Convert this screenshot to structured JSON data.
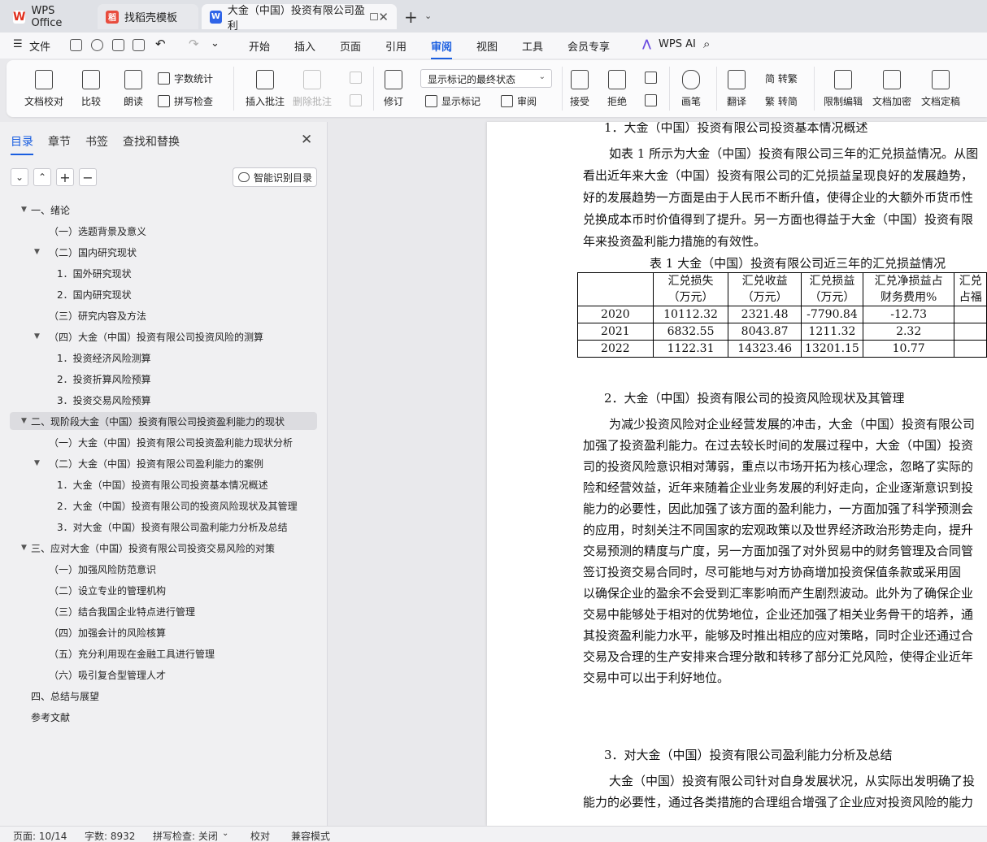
{
  "tabs": {
    "wps": "WPS Office",
    "daoke": "找稻壳模板",
    "doc": "大金（中国）投资有限公司盈利"
  },
  "menu": {
    "file": "文件",
    "items": [
      "开始",
      "插入",
      "页面",
      "引用",
      "审阅",
      "视图",
      "工具",
      "会员专享"
    ],
    "active": "审阅",
    "wps_ai": "WPS AI"
  },
  "ribbon": {
    "doc_check": "文档校对",
    "compare": "比较",
    "read_aloud": "朗读",
    "word_count": "字数统计",
    "spell_check": "拼写检查",
    "insert_comment": "插入批注",
    "delete_comment": "删除批注",
    "revise": "修订",
    "markup_state": "显示标记的最终状态",
    "show_markup": "显示标记",
    "review": "审阅",
    "accept": "接受",
    "reject": "拒绝",
    "pen": "画笔",
    "translate": "翻译",
    "to_traditional": "简 转繁",
    "to_simplified": "繁 转简",
    "restrict_edit": "限制编辑",
    "encrypt": "文档加密",
    "finalize": "文档定稿"
  },
  "nav": {
    "tabs": [
      "目录",
      "章节",
      "书签",
      "查找和替换"
    ],
    "smart_toc": "智能识别目录",
    "toc": [
      {
        "label": "一、绪论",
        "level": 0,
        "toggle": "open"
      },
      {
        "label": "（一）选题背景及意义",
        "level": 1,
        "toggle": ""
      },
      {
        "label": "（二）国内研究现状",
        "level": 1,
        "toggle": "open"
      },
      {
        "label": "1．国外研究现状",
        "level": 2,
        "toggle": ""
      },
      {
        "label": "2．国内研究现状",
        "level": 2,
        "toggle": ""
      },
      {
        "label": "（三）研究内容及方法",
        "level": 1,
        "toggle": ""
      },
      {
        "label": "（四）大金（中国）投资有限公司投资风险的测算",
        "level": 1,
        "toggle": "open"
      },
      {
        "label": "1．投资经济风险测算",
        "level": 2,
        "toggle": ""
      },
      {
        "label": "2．投资折算风险预算",
        "level": 2,
        "toggle": ""
      },
      {
        "label": "3．投资交易风险预算",
        "level": 2,
        "toggle": ""
      },
      {
        "label": "二、现阶段大金（中国）投资有限公司投资盈利能力的现状",
        "level": 0,
        "toggle": "open"
      },
      {
        "label": "（一）大金（中国）投资有限公司投资盈利能力现状分析",
        "level": 1,
        "toggle": ""
      },
      {
        "label": "（二）大金（中国）投资有限公司盈利能力的案例",
        "level": 1,
        "toggle": "open"
      },
      {
        "label": "1．大金（中国）投资有限公司投资基本情况概述",
        "level": 2,
        "toggle": ""
      },
      {
        "label": "2．大金（中国）投资有限公司的投资风险现状及其管理",
        "level": 2,
        "toggle": ""
      },
      {
        "label": "3．对大金（中国）投资有限公司盈利能力分析及总结",
        "level": 2,
        "toggle": ""
      },
      {
        "label": "三、应对大金（中国）投资有限公司投资交易风险的对策",
        "level": 0,
        "toggle": "open"
      },
      {
        "label": "（一）加强风险防范意识",
        "level": 1,
        "toggle": ""
      },
      {
        "label": "（二）设立专业的管理机构",
        "level": 1,
        "toggle": ""
      },
      {
        "label": "（三）结合我国企业特点进行管理",
        "level": 1,
        "toggle": ""
      },
      {
        "label": "（四）加强会计的风险核算",
        "level": 1,
        "toggle": ""
      },
      {
        "label": "（五）充分利用现在金融工具进行管理",
        "level": 1,
        "toggle": ""
      },
      {
        "label": "（六）吸引复合型管理人才",
        "level": 1,
        "toggle": ""
      },
      {
        "label": "四、总结与展望",
        "level": 0,
        "toggle": "none"
      },
      {
        "label": "参考文献",
        "level": 0,
        "toggle": "none"
      }
    ],
    "selected_index": 10
  },
  "doc": {
    "h1": "1．大金（中国）投资有限公司投资基本情况概述",
    "p1": [
      "如表 1 所示为大金（中国）投资有限公司三年的汇兑损益情况。从图",
      "看出近年来大金（中国）投资有限公司的汇兑损益呈现良好的发展趋势，",
      "好的发展趋势一方面是由于人民币不断升值，使得企业的大额外币货币性",
      "兑换成本币时价值得到了提升。另一方面也得益于大金（中国）投资有限",
      "年来投资盈利能力措施的有效性。"
    ],
    "table_caption": "表 1 大金（中国）投资有限公司近三年的汇兑损益情况",
    "table": {
      "headers": [
        "",
        "汇兑损失\n（万元）",
        "汇兑收益\n（万元）",
        "汇兑损益\n（万元）",
        "汇兑净损益占\n财务费用%",
        "汇兑\n占福"
      ],
      "rows": [
        [
          "2020",
          "10112.32",
          "2321.48",
          "-7790.84",
          "-12.73",
          ""
        ],
        [
          "2021",
          "6832.55",
          "8043.87",
          "1211.32",
          "2.32",
          ""
        ],
        [
          "2022",
          "1122.31",
          "14323.46",
          "13201.15",
          "10.77",
          ""
        ]
      ]
    },
    "h2": "2．大金（中国）投资有限公司的投资风险现状及其管理",
    "p2": [
      "为减少投资风险对企业经营发展的冲击，大金（中国）投资有限公司",
      "加强了投资盈利能力。在过去较长时间的发展过程中，大金（中国）投资",
      "司的投资风险意识相对薄弱，重点以市场开拓为核心理念，忽略了实际的",
      "险和经营效益，近年来随着企业业务发展的利好走向，企业逐渐意识到投",
      "能力的必要性，因此加强了该方面的盈利能力，一方面加强了科学预测会",
      "的应用，时刻关注不同国家的宏观政策以及世界经济政治形势走向，提升",
      "交易预测的精度与广度，另一方面加强了对外贸易中的财务管理及合同管",
      "签订投资交易合同时，尽可能地与对方协商增加投资保值条款或采用固",
      "以确保企业的盈余不会受到汇率影响而产生剧烈波动。此外为了确保企业",
      "交易中能够处于相对的优势地位，企业还加强了相关业务骨干的培养，通",
      "其投资盈利能力水平，能够及时推出相应的应对策略，同时企业还通过合",
      "交易及合理的生产安排来合理分散和转移了部分汇兑风险，使得企业近年",
      "交易中可以出于利好地位。"
    ],
    "h3": "3．对大金（中国）投资有限公司盈利能力分析及总结",
    "p3": [
      "大金（中国）投资有限公司针对自身发展状况，从实际出发明确了投",
      "能力的必要性，通过各类措施的合理组合增强了企业应对投资风险的能力"
    ]
  },
  "status": {
    "page": "页面: 10/14",
    "words": "字数: 8932",
    "spell": "拼写检查: 关闭",
    "proof": "校对",
    "compat": "兼容模式"
  },
  "colors": {
    "accent": "#1a5ee0"
  }
}
